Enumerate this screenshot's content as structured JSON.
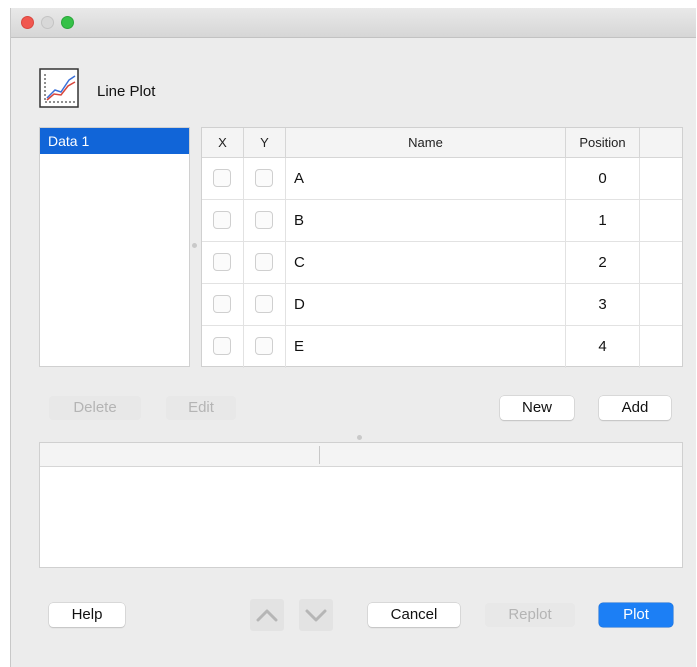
{
  "window": {
    "traffic_lights": [
      "close",
      "minimize",
      "zoom"
    ]
  },
  "header": {
    "icon": "line-plot-icon",
    "title": "Line Plot"
  },
  "datasets": {
    "items": [
      {
        "label": "Data 1",
        "selected": true
      }
    ]
  },
  "table": {
    "columns": [
      "X",
      "Y",
      "Name",
      "Position"
    ],
    "rows": [
      {
        "x": false,
        "y": false,
        "name": "A",
        "position": "0"
      },
      {
        "x": false,
        "y": false,
        "name": "B",
        "position": "1"
      },
      {
        "x": false,
        "y": false,
        "name": "C",
        "position": "2"
      },
      {
        "x": false,
        "y": false,
        "name": "D",
        "position": "3"
      },
      {
        "x": false,
        "y": false,
        "name": "E",
        "position": "4"
      }
    ]
  },
  "actions": {
    "delete": "Delete",
    "edit": "Edit",
    "new": "New",
    "add": "Add"
  },
  "footer": {
    "help": "Help",
    "move_up_icon": "chevron-up-icon",
    "move_down_icon": "chevron-down-icon",
    "cancel": "Cancel",
    "replot": "Replot",
    "plot": "Plot"
  },
  "colors": {
    "selection": "#1165d8",
    "primary_button": "#1c7ff5",
    "window_bg": "#ececec"
  }
}
